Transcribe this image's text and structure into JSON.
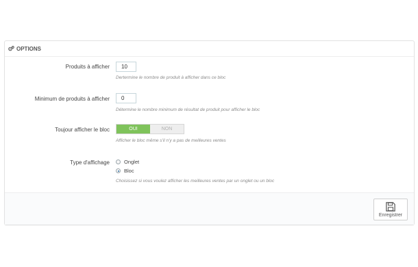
{
  "panel": {
    "heading": "OPTIONS",
    "heading_icon": "gears-icon"
  },
  "fields": {
    "produits": {
      "label": "Produits à afficher",
      "value": "10",
      "help": "Dertermine le nombre de produit à afficher dans ce bloc"
    },
    "minimum": {
      "label": "Minimum de produits à afficher",
      "value": "0",
      "help": "Détermine le nombre minimum de résultat de produit pour afficher le bloc"
    },
    "toujour": {
      "label": "Toujour afficher le bloc",
      "on_label": "OUI",
      "off_label": "NON",
      "selected": "OUI",
      "help": "Afficher le bloc même s'il n'y a pas de meilleures ventes"
    },
    "type": {
      "label": "Type d'affichage",
      "options": [
        "Onglet",
        "Bloc"
      ],
      "selected": "Bloc",
      "help": "Choisissez si vous voulez afficher les meilleures ventes par un onglet ou un bloc"
    }
  },
  "footer": {
    "save_label": "Enregistrer",
    "save_icon": "floppy-disk-icon"
  },
  "colors": {
    "switch_on": "#7fc35b",
    "accent": "#2b6ca3"
  }
}
